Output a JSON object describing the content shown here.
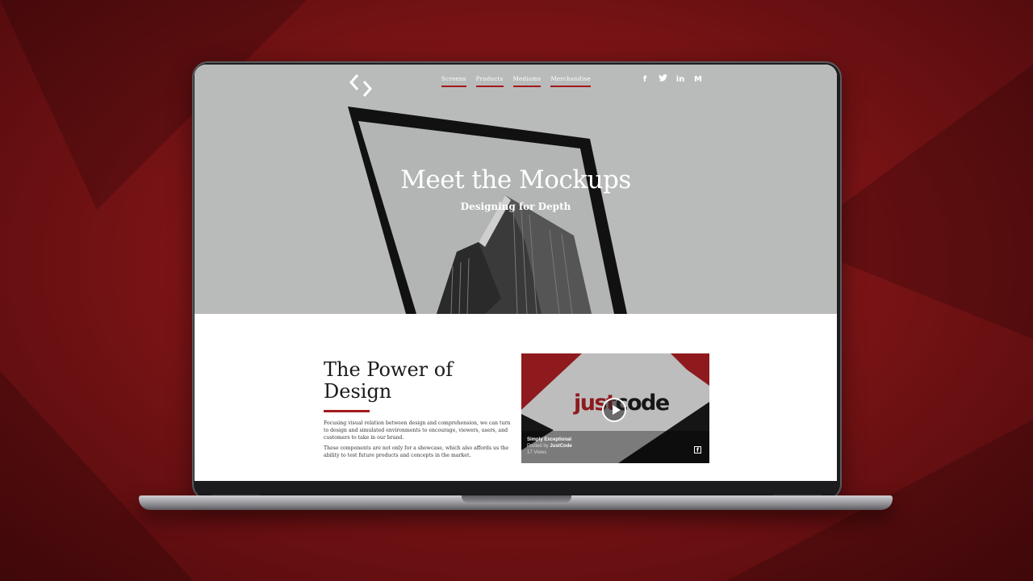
{
  "nav": {
    "items": [
      {
        "label": "Screens"
      },
      {
        "label": "Products"
      },
      {
        "label": "Mediums"
      },
      {
        "label": "Merchandise"
      }
    ]
  },
  "social": {
    "items": [
      {
        "glyph": "f",
        "icon": "facebook-icon"
      },
      {
        "glyph": "🐦",
        "icon": "twitter-icon"
      },
      {
        "glyph": "in",
        "icon": "linkedin-icon"
      },
      {
        "glyph": "M",
        "icon": "medium-icon"
      }
    ]
  },
  "hero": {
    "title": "Meet the Mockups",
    "subtitle": "Designing for Depth"
  },
  "section": {
    "title_line1": "The Power of",
    "title_line2": "Design",
    "paragraph1": "Focusing visual relation between design and comprehension, we can turn to design and simulated environments to encourage, viewers, users, and customers to take in our brand.",
    "paragraph2": "These components are not only for a showcase, which also affords us the ability to test future products and concepts in the market."
  },
  "video": {
    "brand_part1": "just",
    "brand_part2": "code",
    "title": "Simply Exceptional",
    "posted_by_prefix": "Posted by ",
    "posted_by": "JustCode",
    "views": "17 Views",
    "fb_glyph": "f"
  },
  "colors": {
    "accent": "#a4181b",
    "background": "#7c1416",
    "hero_gray": "#b9bbbb"
  }
}
